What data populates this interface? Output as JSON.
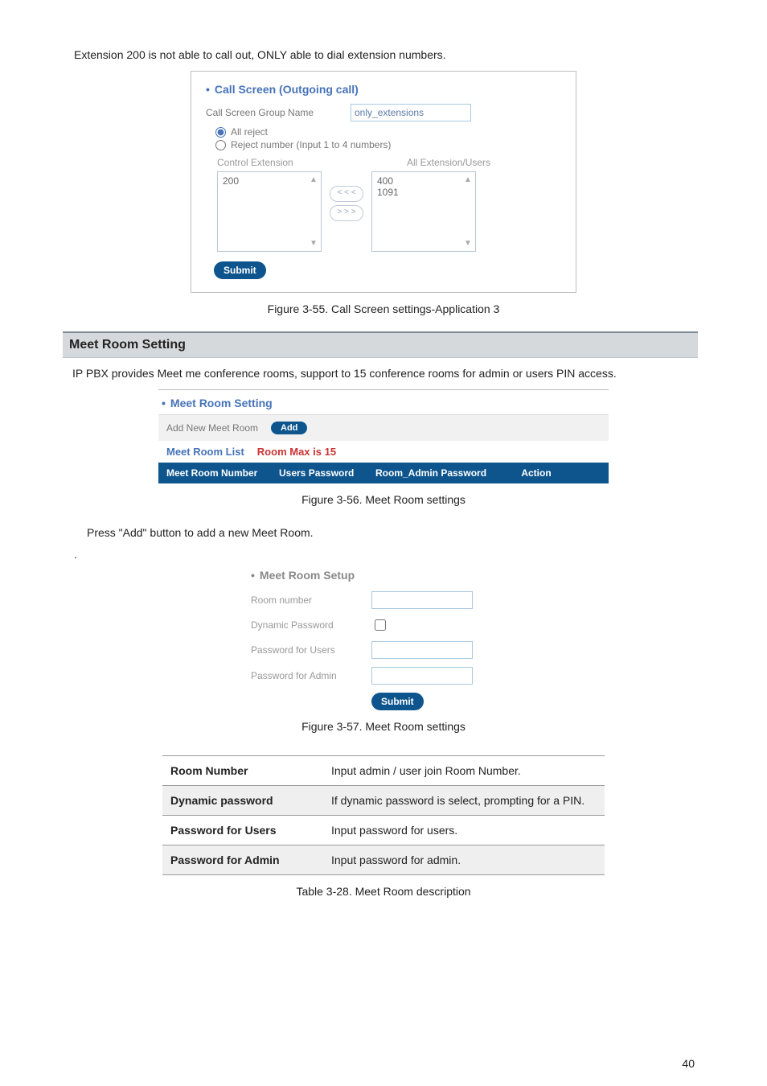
{
  "intro_text": "Extension 200 is not able to call out, ONLY able to dial extension numbers.",
  "call_screen": {
    "title": "Call Screen (Outgoing call)",
    "group_label": "Call Screen Group Name",
    "group_value": "only_extensions",
    "radio1": "All reject",
    "radio2": "Reject number (Input 1 to 4 numbers)",
    "col1": "Control Extension",
    "col2": "All Extension/Users",
    "left_item": "200",
    "right_item1": "400",
    "right_item2": "1091",
    "btn_left": "< < <",
    "btn_right": "> > >",
    "submit": "Submit"
  },
  "caption1": "Figure 3-55. Call Screen settings-Application 3",
  "section_title": "Meet Room Setting",
  "section_body1": "IP PBX provides Meet me conference rooms, support to 15 conference rooms for admin or users PIN access.",
  "mrs": {
    "title": "Meet Room Setting",
    "add_label": "Add New Meet Room",
    "add_btn": "Add",
    "list_title": "Meet Room List",
    "list_max": "Room Max is 15",
    "h1": "Meet Room Number",
    "h2": "Users Password",
    "h3": "Room_Admin Password",
    "h4": "Action"
  },
  "caption2": "Figure 3-56. Meet Room settings",
  "press_add": "Press \"Add\" button to add a new Meet Room.",
  "setup": {
    "title": "Meet Room Setup",
    "row1": "Room number",
    "row2": "Dynamic Password",
    "row3": "Password for Users",
    "row4": "Password for Admin",
    "submit": "Submit"
  },
  "caption3": "Figure 3-57. Meet Room settings",
  "desc_table": {
    "r1k": "Room Number",
    "r1v": "Input admin / user join Room Number.",
    "r2k": "Dynamic password",
    "r2v": "If dynamic password is select, prompting for a PIN.",
    "r3k": "Password for Users",
    "r3v": "Input password for users.",
    "r4k": "Password for Admin",
    "r4v": "Input password for admin."
  },
  "caption4": "Table 3-28. Meet Room description",
  "page_number": "40"
}
